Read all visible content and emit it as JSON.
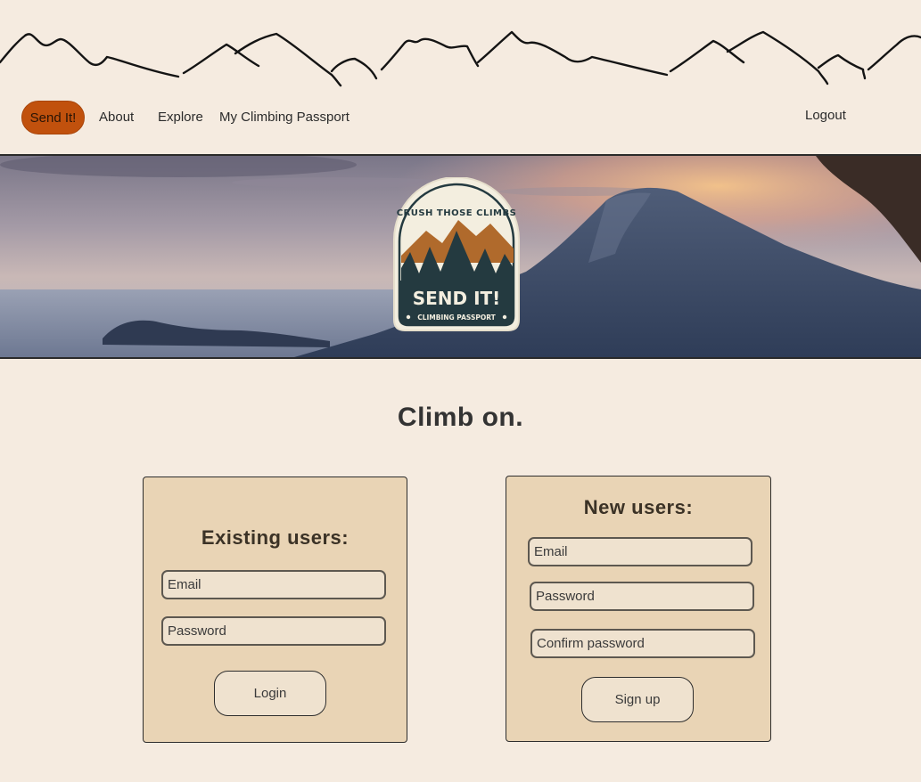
{
  "nav": {
    "brand_label": "Send It!",
    "about_label": "About",
    "explore_label": "Explore",
    "passport_label": "My Climbing Passport",
    "logout_label": "Logout"
  },
  "hero": {
    "badge_arc_text": "CRUSH THOSE CLIMBS",
    "badge_title": "SEND IT!",
    "badge_subtitle": "CLIMBING PASSPORT"
  },
  "main": {
    "title": "Climb on."
  },
  "login": {
    "heading": "Existing users:",
    "email_placeholder": "Email",
    "password_placeholder": "Password",
    "button_label": "Login"
  },
  "signup": {
    "heading": "New users:",
    "email_placeholder": "Email",
    "password_placeholder": "Password",
    "confirm_placeholder": "Confirm password",
    "button_label": "Sign up"
  },
  "colors": {
    "background": "#f5ebe0",
    "accent": "#c1510d",
    "card": "#e9d4b5",
    "badge_dark": "#243a40",
    "badge_light": "#f3eedf"
  }
}
